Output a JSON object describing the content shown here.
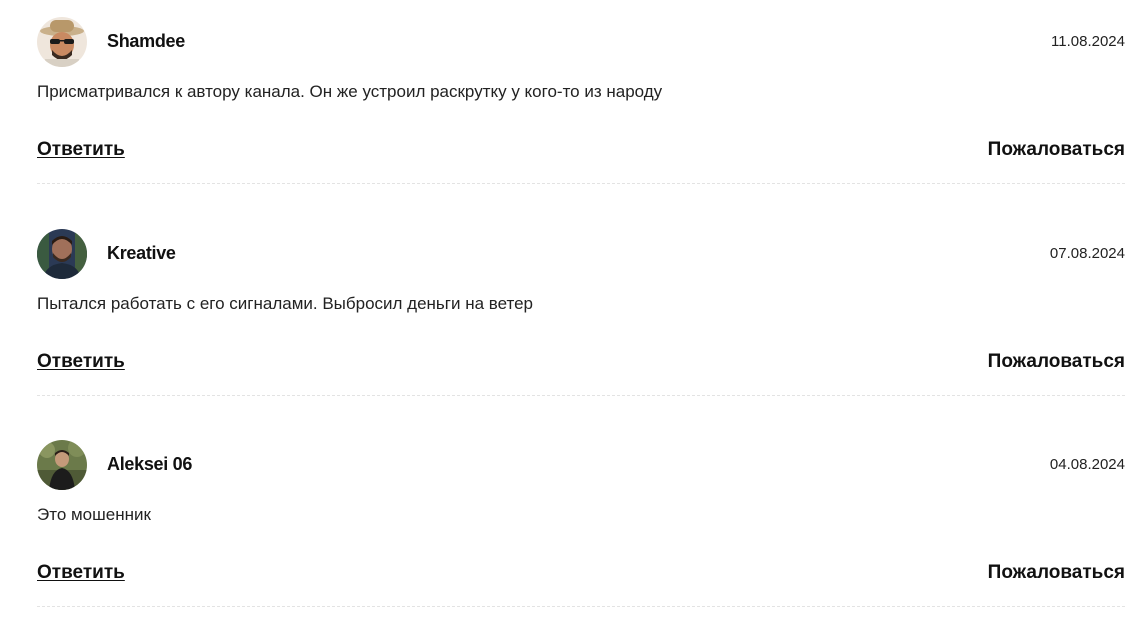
{
  "comments": [
    {
      "author": "Shamdee",
      "date": "11.08.2024",
      "text": "Присматривался к автору канала. Он же устроил раскрутку у кого-то из народу",
      "avatar_icon": "user-avatar-hat-sunglasses"
    },
    {
      "author": "Kreative",
      "date": "07.08.2024",
      "text": "Пытался работать с его сигналами. Выбросил деньги на ветер",
      "avatar_icon": "user-avatar-man-bearded"
    },
    {
      "author": "Aleksei 06",
      "date": "04.08.2024",
      "text": "Это мошенник",
      "avatar_icon": "user-avatar-man-outdoor"
    }
  ],
  "actions": {
    "reply_label": "Ответить",
    "report_label": "Пожаловаться"
  }
}
